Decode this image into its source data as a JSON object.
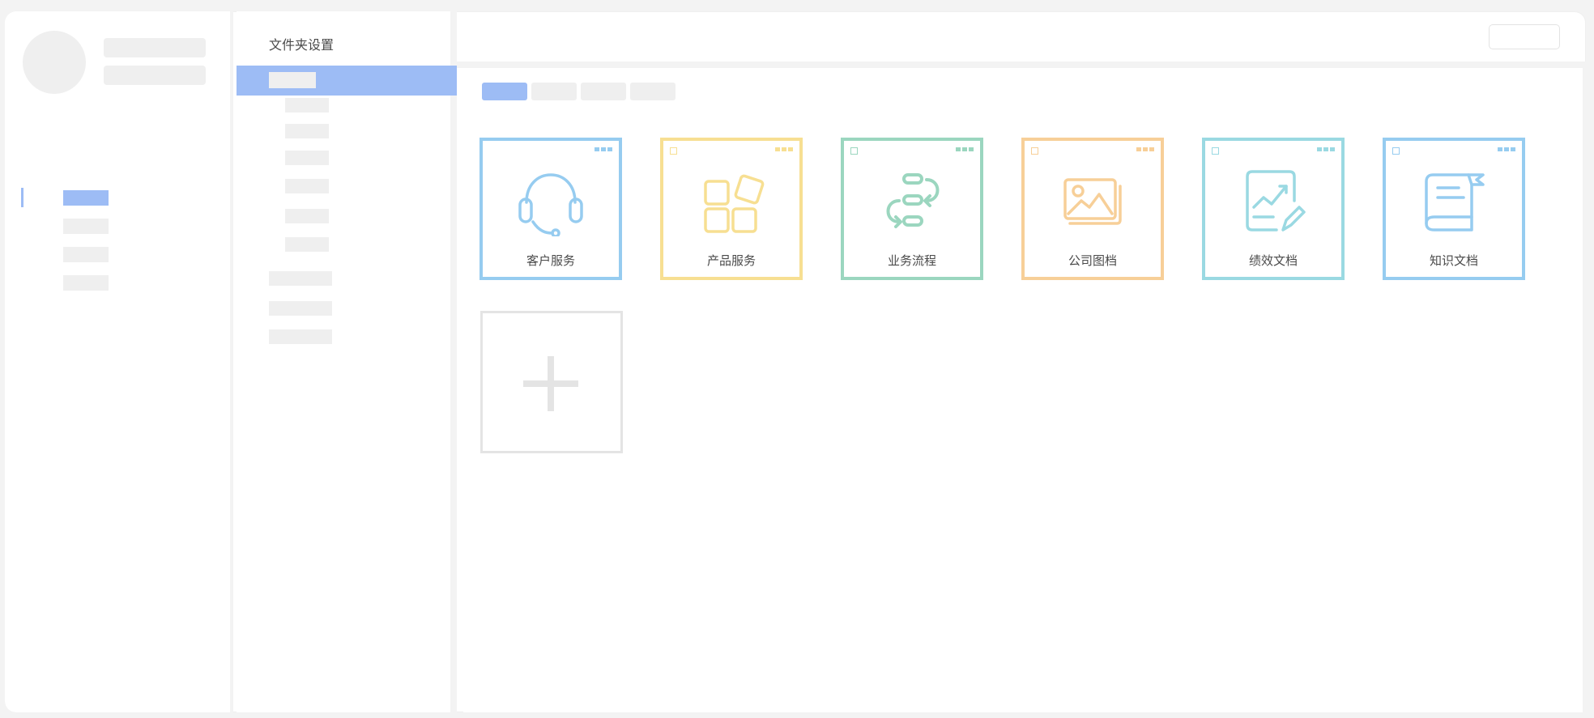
{
  "header": {
    "title": "文件夹设置"
  },
  "colors": {
    "accent": "#9dbcf5",
    "placeholder": "#efefef",
    "blue": "#96ccf0",
    "yellow": "#f7df92",
    "green": "#9bd6bf",
    "orange": "#f7cf98",
    "cyan": "#9ad9e2"
  },
  "folders": [
    {
      "name": "客户服务",
      "icon": "headset-icon",
      "color": "#96ccf0"
    },
    {
      "name": "产品服务",
      "icon": "product-blocks-icon",
      "color": "#f7df92"
    },
    {
      "name": "业务流程",
      "icon": "workflow-icon",
      "color": "#9bd6bf"
    },
    {
      "name": "公司图档",
      "icon": "image-gallery-icon",
      "color": "#f7cf98"
    },
    {
      "name": "绩效文档",
      "icon": "performance-chart-icon",
      "color": "#9ad9e2"
    },
    {
      "name": "知识文档",
      "icon": "knowledge-book-icon",
      "color": "#96ccf0"
    }
  ],
  "add_card": {
    "icon": "plus-icon"
  }
}
